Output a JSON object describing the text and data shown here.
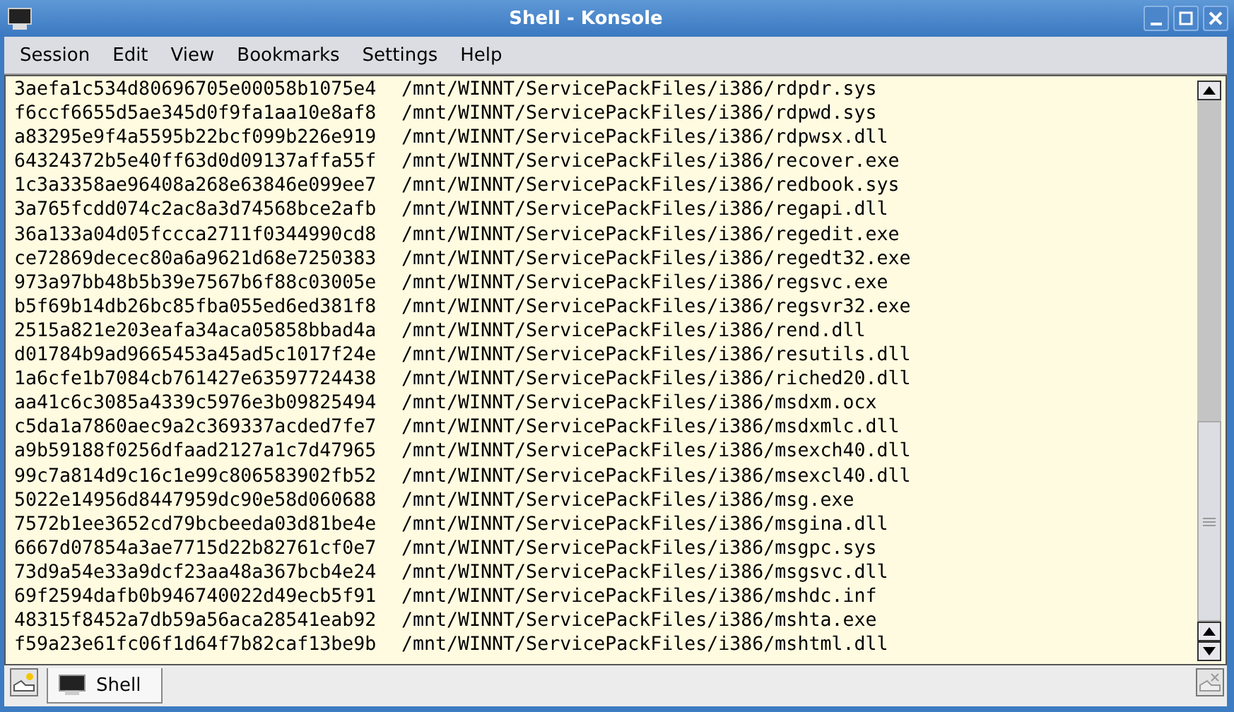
{
  "window": {
    "title": "Shell - Konsole"
  },
  "menu": [
    "Session",
    "Edit",
    "View",
    "Bookmarks",
    "Settings",
    "Help"
  ],
  "lines": [
    {
      "hash": "3aefa1c534d80696705e00058b1075e4",
      "path": "/mnt/WINNT/ServicePackFiles/i386/rdpdr.sys"
    },
    {
      "hash": "f6ccf6655d5ae345d0f9fa1aa10e8af8",
      "path": "/mnt/WINNT/ServicePackFiles/i386/rdpwd.sys"
    },
    {
      "hash": "a83295e9f4a5595b22bcf099b226e919",
      "path": "/mnt/WINNT/ServicePackFiles/i386/rdpwsx.dll"
    },
    {
      "hash": "64324372b5e40ff63d0d09137affa55f",
      "path": "/mnt/WINNT/ServicePackFiles/i386/recover.exe"
    },
    {
      "hash": "1c3a3358ae96408a268e63846e099ee7",
      "path": "/mnt/WINNT/ServicePackFiles/i386/redbook.sys"
    },
    {
      "hash": "3a765fcdd074c2ac8a3d74568bce2afb",
      "path": "/mnt/WINNT/ServicePackFiles/i386/regapi.dll"
    },
    {
      "hash": "36a133a04d05fccca2711f0344990cd8",
      "path": "/mnt/WINNT/ServicePackFiles/i386/regedit.exe"
    },
    {
      "hash": "ce72869decec80a6a9621d68e7250383",
      "path": "/mnt/WINNT/ServicePackFiles/i386/regedt32.exe"
    },
    {
      "hash": "973a97bb48b5b39e7567b6f88c03005e",
      "path": "/mnt/WINNT/ServicePackFiles/i386/regsvc.exe"
    },
    {
      "hash": "b5f69b14db26bc85fba055ed6ed381f8",
      "path": "/mnt/WINNT/ServicePackFiles/i386/regsvr32.exe"
    },
    {
      "hash": "2515a821e203eafa34aca05858bbad4a",
      "path": "/mnt/WINNT/ServicePackFiles/i386/rend.dll"
    },
    {
      "hash": "d01784b9ad9665453a45ad5c1017f24e",
      "path": "/mnt/WINNT/ServicePackFiles/i386/resutils.dll"
    },
    {
      "hash": "1a6cfe1b7084cb761427e63597724438",
      "path": "/mnt/WINNT/ServicePackFiles/i386/riched20.dll"
    },
    {
      "hash": "aa41c6c3085a4339c5976e3b09825494",
      "path": "/mnt/WINNT/ServicePackFiles/i386/msdxm.ocx"
    },
    {
      "hash": "c5da1a7860aec9a2c369337acded7fe7",
      "path": "/mnt/WINNT/ServicePackFiles/i386/msdxmlc.dll"
    },
    {
      "hash": "a9b59188f0256dfaad2127a1c7d47965",
      "path": "/mnt/WINNT/ServicePackFiles/i386/msexch40.dll"
    },
    {
      "hash": "99c7a814d9c16c1e99c806583902fb52",
      "path": "/mnt/WINNT/ServicePackFiles/i386/msexcl40.dll"
    },
    {
      "hash": "5022e14956d8447959dc90e58d060688",
      "path": "/mnt/WINNT/ServicePackFiles/i386/msg.exe"
    },
    {
      "hash": "7572b1ee3652cd79bcbeeda03d81be4e",
      "path": "/mnt/WINNT/ServicePackFiles/i386/msgina.dll"
    },
    {
      "hash": "6667d07854a3ae7715d22b82761cf0e7",
      "path": "/mnt/WINNT/ServicePackFiles/i386/msgpc.sys"
    },
    {
      "hash": "73d9a54e33a9dcf23aa48a367bcb4e24",
      "path": "/mnt/WINNT/ServicePackFiles/i386/msgsvc.dll"
    },
    {
      "hash": "69f2594dafb0b946740022d49ecb5f91",
      "path": "/mnt/WINNT/ServicePackFiles/i386/mshdc.inf"
    },
    {
      "hash": "48315f8452a7db59a56aca28541eab92",
      "path": "/mnt/WINNT/ServicePackFiles/i386/mshta.exe"
    },
    {
      "hash": "f59a23e61fc06f1d64f7b82caf13be9b",
      "path": "/mnt/WINNT/ServicePackFiles/i386/mshtml.dll"
    }
  ],
  "tabs": [
    {
      "label": "Shell",
      "selected": true
    }
  ]
}
